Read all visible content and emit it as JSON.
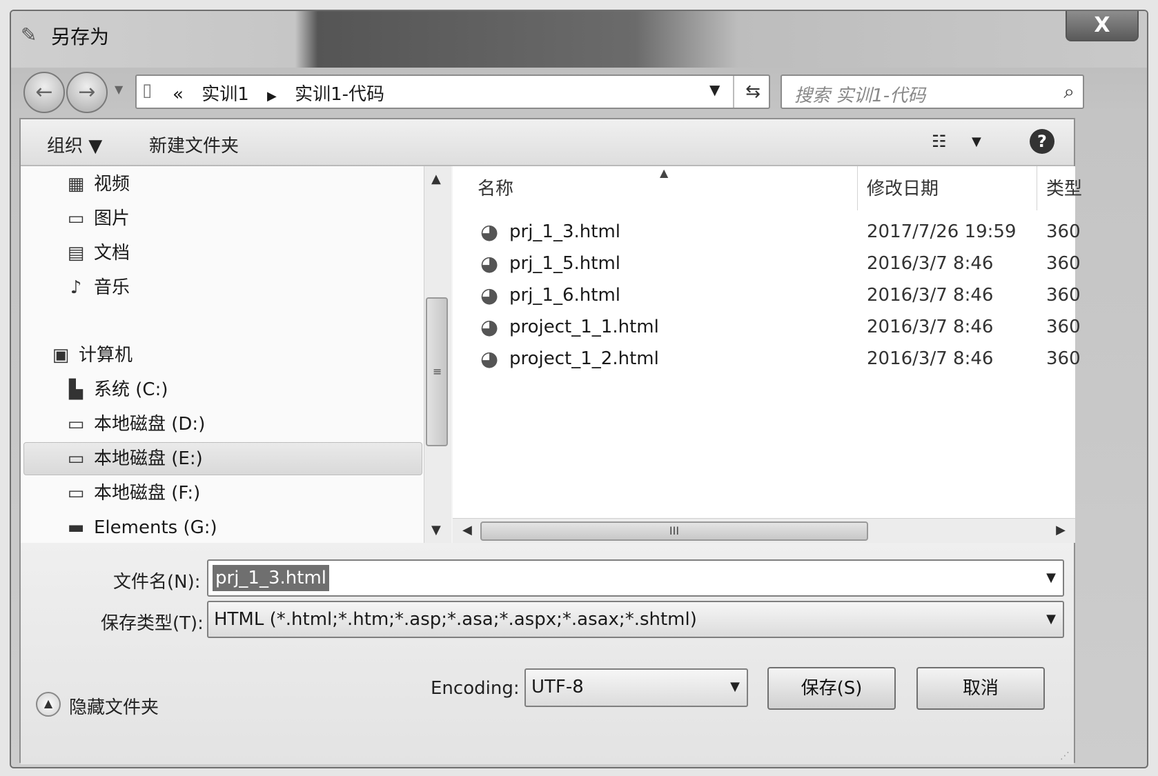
{
  "window": {
    "title": "另存为",
    "close_label": "X"
  },
  "navigation": {
    "back_icon": "back-arrow-icon",
    "forward_icon": "forward-arrow-icon",
    "address_prefix": "«",
    "breadcrumb": [
      "实训1",
      "实训1-代码"
    ],
    "search_placeholder": "搜索 实训1-代码"
  },
  "toolbar": {
    "organize_label": "组织 ▼",
    "new_folder_label": "新建文件夹"
  },
  "sidebar": {
    "libraries": [
      {
        "icon": "video-icon",
        "label": "视频"
      },
      {
        "icon": "pictures-icon",
        "label": "图片"
      },
      {
        "icon": "documents-icon",
        "label": "文档"
      },
      {
        "icon": "music-icon",
        "label": "音乐"
      }
    ],
    "computer_label": "计算机",
    "drives": [
      {
        "icon": "system-drive-icon",
        "label": "系统 (C:)"
      },
      {
        "icon": "hard-drive-icon",
        "label": "本地磁盘 (D:)"
      },
      {
        "icon": "hard-drive-icon",
        "label": "本地磁盘 (E:)",
        "selected": true
      },
      {
        "icon": "hard-drive-icon",
        "label": "本地磁盘 (F:)"
      },
      {
        "icon": "wd-drive-icon",
        "label": "Elements (G:)"
      }
    ]
  },
  "file_list": {
    "columns": [
      "名称",
      "修改日期",
      "类型"
    ],
    "files": [
      {
        "name": "prj_1_3.html",
        "date": "2017/7/26 19:59",
        "type": "360"
      },
      {
        "name": "prj_1_5.html",
        "date": "2016/3/7 8:46",
        "type": "360"
      },
      {
        "name": "prj_1_6.html",
        "date": "2016/3/7 8:46",
        "type": "360"
      },
      {
        "name": "project_1_1.html",
        "date": "2016/3/7 8:46",
        "type": "360"
      },
      {
        "name": "project_1_2.html",
        "date": "2016/3/7 8:46",
        "type": "360"
      }
    ],
    "scroll_grip": "III"
  },
  "form": {
    "filename_label": "文件名(N):",
    "filename_value": "prj_1_3.html",
    "filetype_label": "保存类型(T):",
    "filetype_value": "HTML (*.html;*.htm;*.asp;*.asa;*.aspx;*.asax;*.shtml)",
    "encoding_label": "Encoding:",
    "encoding_value": "UTF-8",
    "hide_folders_label": "隐藏文件夹",
    "save_label": "保存(S)",
    "cancel_label": "取消"
  }
}
